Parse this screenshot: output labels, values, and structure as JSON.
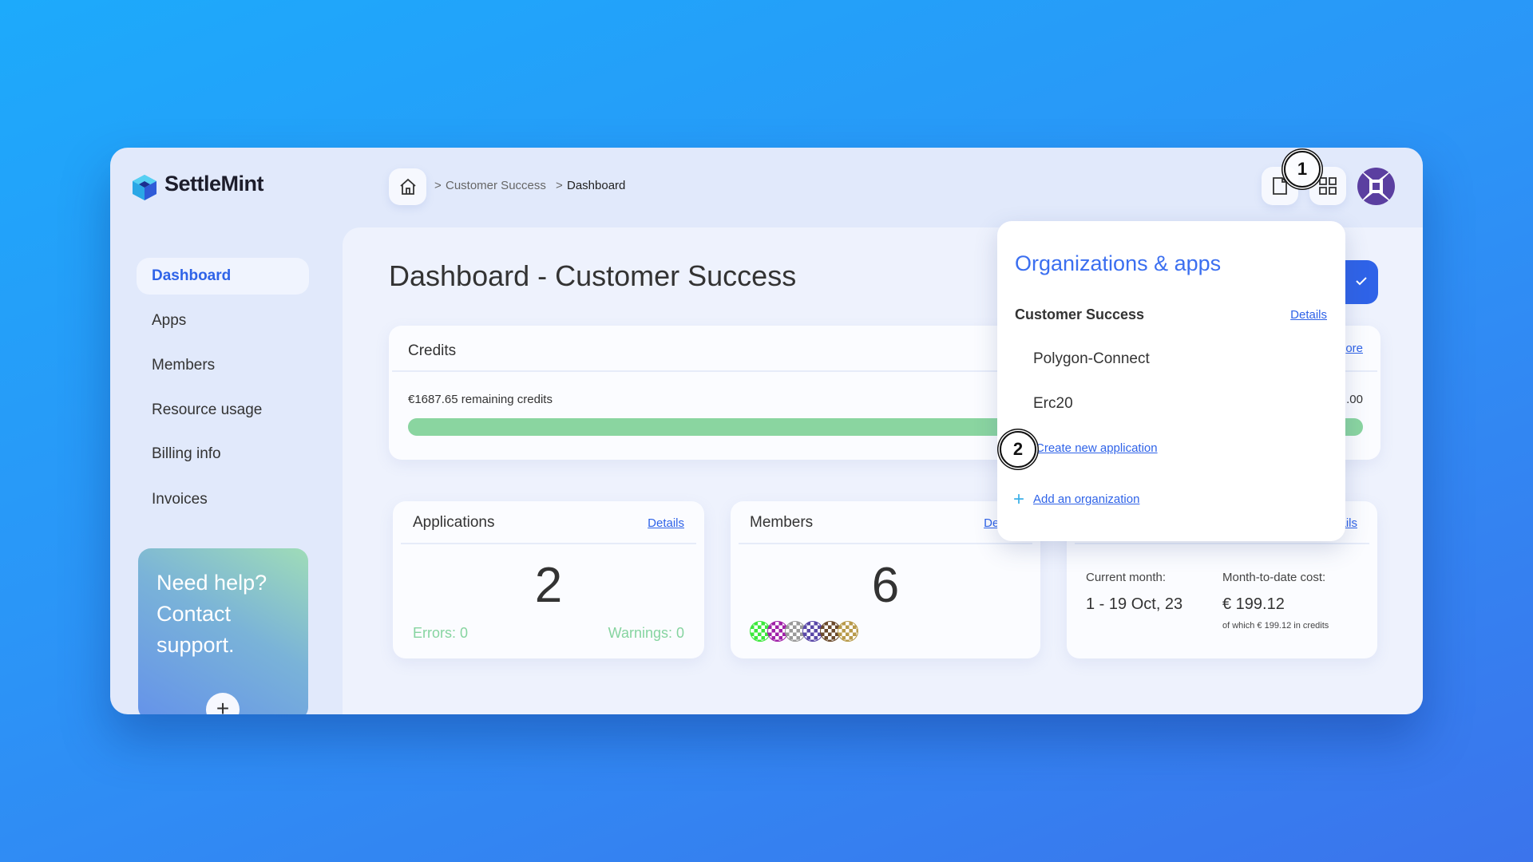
{
  "brand": {
    "name": "SettleMint"
  },
  "breadcrumb": {
    "items": [
      "Customer Success",
      "Dashboard"
    ],
    "separator": ">"
  },
  "sidebar": {
    "items": [
      {
        "label": "Dashboard",
        "active": true
      },
      {
        "label": "Apps"
      },
      {
        "label": "Members"
      },
      {
        "label": "Resource usage"
      },
      {
        "label": "Billing info"
      },
      {
        "label": "Invoices"
      }
    ]
  },
  "help": {
    "line1": "Need help?",
    "line2": "Contact",
    "line3": "support.",
    "button": "+"
  },
  "page": {
    "title": "Dashboard - Customer Success"
  },
  "credits": {
    "title": "Credits",
    "remaining": "€1687.65 remaining credits",
    "link_partial": "ore",
    "amount_partial": ".00",
    "progress_percent": 100,
    "bar_color": "#8ad5a0"
  },
  "applications": {
    "title": "Applications",
    "details": "Details",
    "count": "2",
    "errors": "Errors: 0",
    "warnings": "Warnings: 0"
  },
  "members": {
    "title": "Members",
    "details": "Details",
    "count": "6",
    "avatar_colors": [
      "#3de83d",
      "#a020a8",
      "#9a9a9a",
      "#5a48a8",
      "#6b4a2c",
      "#b89a4a"
    ]
  },
  "billing": {
    "details": "Details",
    "current_month_label": "Current month:",
    "current_month_value": "1 - 19 Oct, 23",
    "cost_label": "Month-to-date cost:",
    "cost_value": "€ 199.12",
    "cost_note": "of which € 199.12 in credits"
  },
  "dropdown": {
    "title": "Organizations & apps",
    "org_name": "Customer Success",
    "org_details": "Details",
    "apps": [
      "Polygon-Connect",
      "Erc20"
    ],
    "create_app": "Create new application",
    "add_org": "Add an organization",
    "add_icon": "+"
  },
  "annotations": [
    "1",
    "2"
  ],
  "colors": {
    "accent": "#2f63e8",
    "success": "#86d4a0",
    "avatar": "#5b3fa0"
  }
}
